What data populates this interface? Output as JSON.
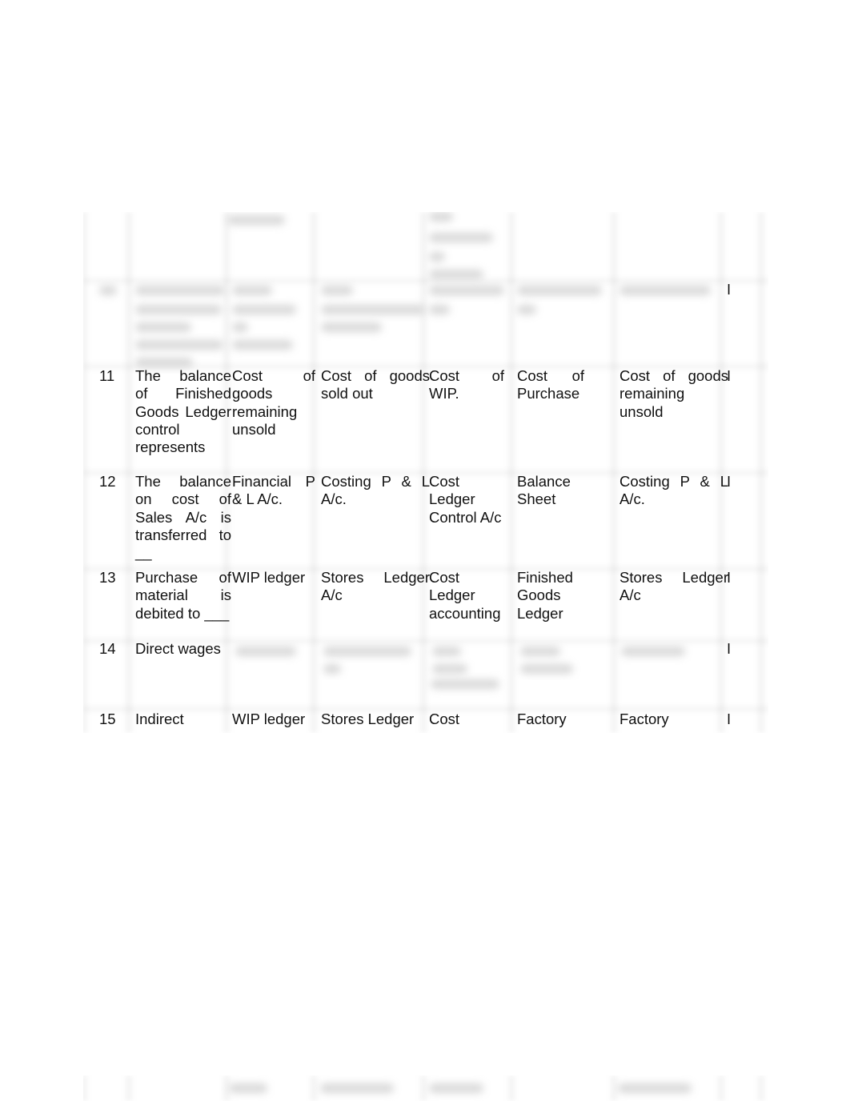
{
  "document": {
    "table_rows": [
      {
        "number": "11",
        "question": "The balance of Finished Goods Ledger control represents",
        "option_a": "Cost of goods remaining unsold",
        "option_b": "Cost of goods sold out",
        "option_c": "Cost of WIP.",
        "option_d": "Cost of Purchase",
        "answer": "Cost of goods remaining unsold",
        "level": "I"
      },
      {
        "number": "12",
        "question": "The balance on cost of Sales A/c is transferred to __",
        "option_a": "Financial P & L A/c.",
        "option_b": "Costing P & L A/c.",
        "option_c": "Cost Ledger Control A/c",
        "option_d": "Balance Sheet",
        "answer": "Costing P & L A/c.",
        "level": "I"
      },
      {
        "number": "13",
        "question": "Purchase of material is debited to ___",
        "option_a": "WIP ledger",
        "option_b": "Stores Ledger A/c",
        "option_c": "Cost Ledger accounting",
        "option_d": "Finished Goods Ledger",
        "answer": "Stores Ledger A/c",
        "level": "I"
      },
      {
        "number": "14",
        "question": "Direct wages",
        "level": "I"
      },
      {
        "number": "15",
        "question": "Indirect",
        "option_a": "WIP ledger",
        "option_b": "Stores Ledger",
        "option_c": "Cost",
        "option_d": "Factory",
        "answer": "Factory",
        "level": "I"
      }
    ],
    "blurred_row_level": "I"
  }
}
